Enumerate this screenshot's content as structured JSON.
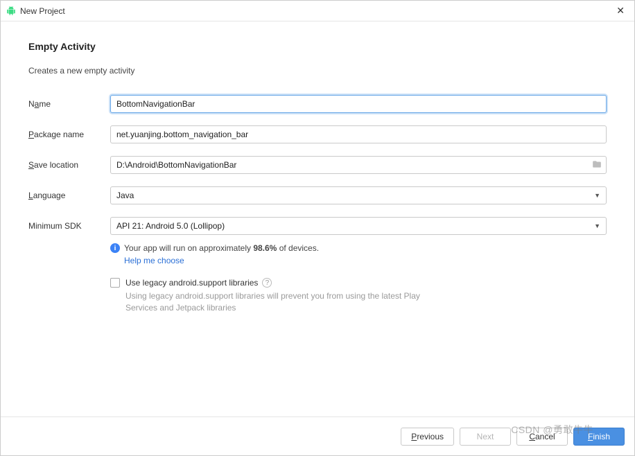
{
  "window": {
    "title": "New Project"
  },
  "section": {
    "heading": "Empty Activity",
    "subtitle": "Creates a new empty activity"
  },
  "labels": {
    "name_pre": "N",
    "name_ul": "a",
    "name_post": "me",
    "package_ul": "P",
    "package_post": "ackage name",
    "save_ul": "S",
    "save_post": "ave location",
    "language_ul": "L",
    "language_post": "anguage",
    "minsdk": "Minimum SDK"
  },
  "fields": {
    "name": "BottomNavigationBar",
    "package": "net.yuanjing.bottom_navigation_bar",
    "save_location": "D:\\Android\\BottomNavigationBar",
    "language": "Java",
    "minimum_sdk": "API 21: Android 5.0 (Lollipop)"
  },
  "info": {
    "text_pre": "Your app will run on approximately ",
    "percent": "98.6%",
    "text_post": " of devices.",
    "help": "Help me choose"
  },
  "legacy": {
    "checkbox_label": "Use legacy android.support libraries",
    "description": "Using legacy android.support libraries will prevent you from using the latest Play Services and Jetpack libraries"
  },
  "buttons": {
    "previous_ul": "P",
    "previous_post": "revious",
    "next": "Next",
    "cancel_ul": "C",
    "cancel_post": "ancel",
    "finish_ul": "F",
    "finish_post": "inish"
  },
  "watermark": "CSDN @勇敢牛牛"
}
